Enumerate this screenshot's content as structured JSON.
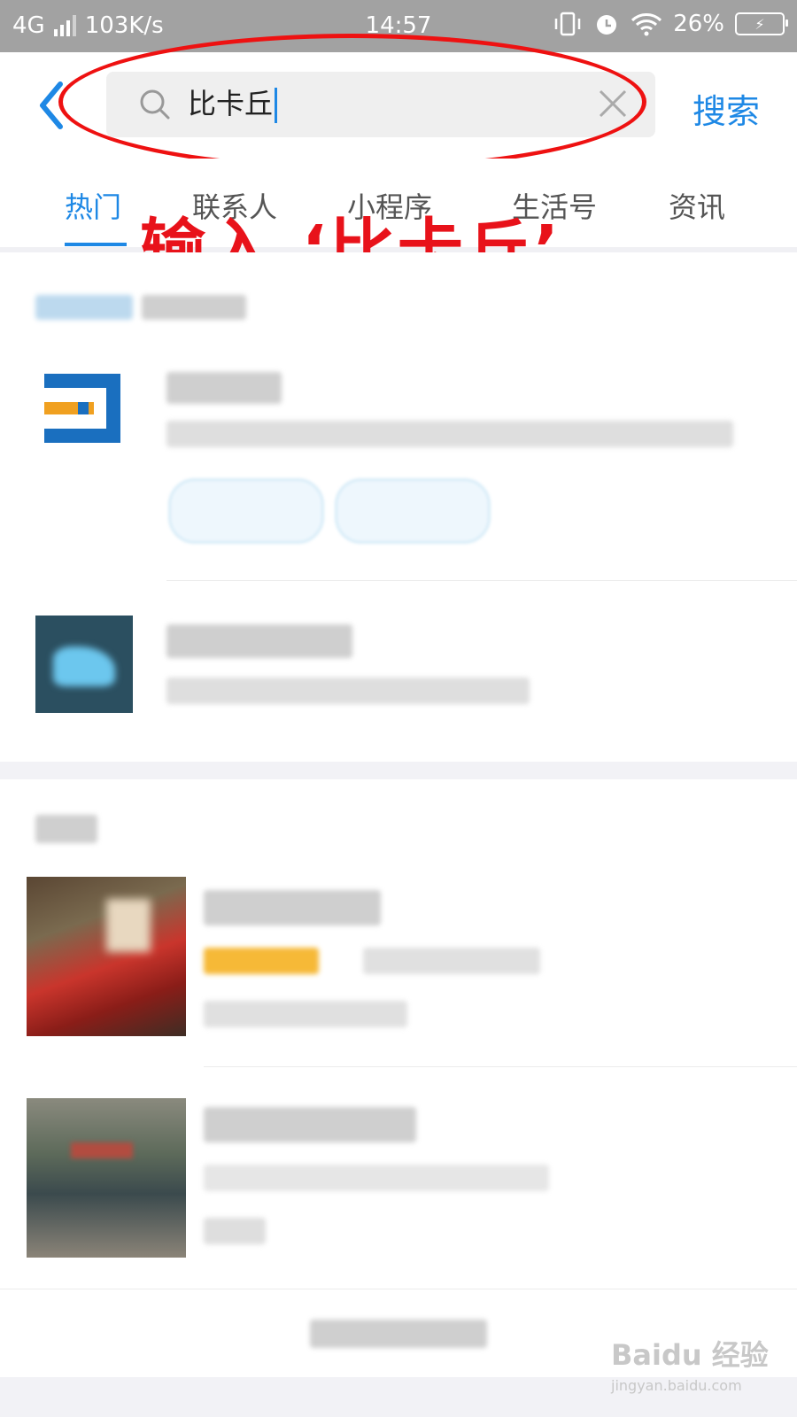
{
  "status_bar": {
    "network": "4G",
    "speed": "103K/s",
    "time": "14:57",
    "battery": "26%"
  },
  "search": {
    "query": "比卡丘",
    "button_label": "搜索"
  },
  "tabs": [
    {
      "label": "热门",
      "active": true
    },
    {
      "label": "联系人",
      "active": false
    },
    {
      "label": "小程序",
      "active": false
    },
    {
      "label": "生活号",
      "active": false
    },
    {
      "label": "资讯",
      "active": false
    }
  ],
  "annotation": "输入 ‘比卡丘’",
  "watermark": {
    "brand": "Baidu 经验",
    "url": "jingyan.baidu.com"
  },
  "colors": {
    "accent": "#1e88e5",
    "annotation": "#e8121a",
    "status_bar": "#a2a2a2"
  }
}
